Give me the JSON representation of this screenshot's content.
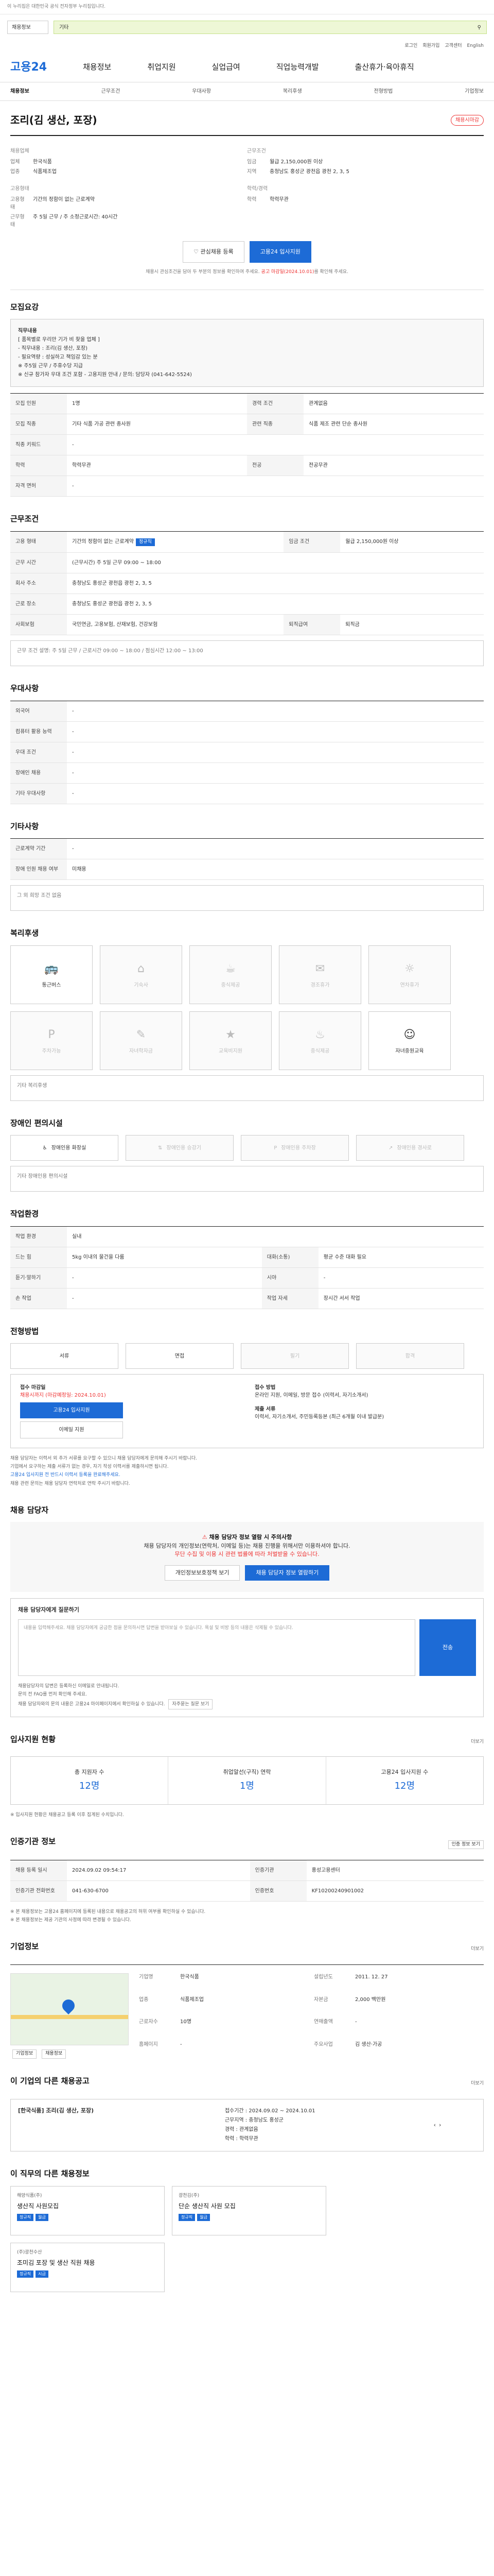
{
  "topbar": {
    "text": "이 누리집은 대한민국 공식 전자정부 누리집입니다."
  },
  "search": {
    "category": "채용정보",
    "query": "기타"
  },
  "gnb_top": [
    "로그인",
    "회원가입",
    "고객센터",
    "English"
  ],
  "gnb": {
    "logo": "고용24",
    "items": [
      "채용정보",
      "취업지원",
      "실업급여",
      "직업능력개발",
      "출산휴가·육아휴직"
    ]
  },
  "subnav": [
    "채용정보",
    "근무조건",
    "우대사항",
    "복리후생",
    "전형방법",
    "기업정보"
  ],
  "title": "조리(김 생산, 포장)",
  "status": "채용시마감",
  "company": {
    "label": "채용업체",
    "name_k": "업체",
    "name": "한국식품",
    "type_k": "업종",
    "type": "식품제조업"
  },
  "conditions": {
    "label": "근무조건",
    "pay_k": "임금",
    "pay": "월급 2,150,000원 이상",
    "loc_k": "지역",
    "loc": "충청남도 홍성군 광천읍 광천 2, 3, 5"
  },
  "qual": {
    "label": "고용형태",
    "emp_k": "고용형태",
    "emp": "기간의 정함이 없는 근로계약",
    "hours_k": "근무형태",
    "hours": "주 5일 근무 / 주 소정근로시간: 40시간"
  },
  "career": {
    "label": "학력/경력",
    "edu_k": "학력",
    "edu": "학력무관"
  },
  "buttons": {
    "interest": "관심채용 등록",
    "apply": "고용24 입사지원"
  },
  "notice": {
    "pre": "채용시 관심조건을 담아 두 부분의 정보를 확인하여 주세요. ",
    "red": "공고 마감일(2024.10.01)",
    "post": "를 확인해 주세요."
  },
  "recruit": {
    "title": "모집요강",
    "box_title": "직무내용",
    "box_lines": [
      "[ 품목별로 우리만 기가 비 찾을 업체 ]",
      "- 직무내용 : 조리(김 생산, 포장)",
      "- 필요역량 : 성실하고 책임감 있는 분",
      "※ 주5일 근무 / 주휴수당 지급",
      "※ 신규 참가자 우대 조건 포함 - 고용지원 안내 / 문의: 담당자 (041-642-5524)"
    ],
    "rows": [
      {
        "k1": "모집 인원",
        "v1": "1명",
        "k2": "경력 조건",
        "v2": "관계없음"
      },
      {
        "k1": "모집 직종",
        "v1": "기타 식품 가공 관련 종사원",
        "k2": "관련 직종",
        "v2": "식품 제조 관련 단순 종사원"
      },
      {
        "k1": "직종 키워드",
        "v1": "-",
        "k2": "",
        "v2": ""
      },
      {
        "k1": "학력",
        "v1": "학력무관",
        "k2": "전공",
        "v2": "전공무관"
      },
      {
        "k1": "자격 면허",
        "v1": "-",
        "k2": "",
        "v2": ""
      }
    ]
  },
  "work": {
    "title": "근무조건",
    "rows": [
      {
        "k1": "고용 형태",
        "v1": "기간의 정함이 없는 근로계약",
        "tag": "정규직",
        "k2": "임금 조건",
        "v2": "월급 2,150,000원 이상"
      },
      {
        "k1": "근무 시간",
        "v1": "(근무시간) 주 5일 근무 09:00 ~ 18:00",
        "tag": "",
        "k2": "",
        "v2": ""
      },
      {
        "k1": "회사 주소",
        "v1": "충청남도 홍성군 광천읍 광천 2, 3, 5",
        "tag": "",
        "k2": "",
        "v2": ""
      },
      {
        "k1": "근로 장소",
        "v1": "충청남도 홍성군 광천읍 광천 2, 3, 5",
        "tag": "",
        "k2": "",
        "v2": ""
      },
      {
        "k1": "사회보험",
        "v1": "국민연금, 고용보험, 산재보험, 건강보험",
        "tag": "",
        "k2": "퇴직급여",
        "v2": "퇴직금"
      }
    ],
    "extra": "근무 조건 설명: 주 5일 근무 / 근로시간 09:00 ~ 18:00 / 점심시간 12:00 ~ 13:00"
  },
  "preferences": {
    "title": "우대사항",
    "rows": [
      {
        "k": "외국어",
        "v": "-"
      },
      {
        "k": "컴퓨터 활용 능력",
        "v": "-"
      },
      {
        "k": "우대 조건",
        "v": "-"
      },
      {
        "k": "장애인 채용",
        "v": "-"
      },
      {
        "k": "기타 우대사항",
        "v": "-"
      }
    ]
  },
  "other": {
    "title": "기타사항",
    "rows": [
      {
        "k": "근로계약 기간",
        "v": "-"
      },
      {
        "k": "장애 인원 채용 여부",
        "v": "미채용"
      }
    ],
    "box": "그 외 희망 조건 없음"
  },
  "welfare": {
    "title": "복리후생",
    "items": [
      "통근버스",
      "기숙사",
      "중식제공",
      "경조휴가",
      "연차휴가",
      "주차가능",
      "자녀학자금",
      "교육비지원",
      "중식제공",
      "자녀중원교육"
    ],
    "active": [
      0,
      9
    ],
    "note": "기타 복리후생"
  },
  "disability": {
    "title": "장애인 편의시설",
    "items": [
      "장애인용 화장실",
      "장애인용 승강기",
      "장애인용 주차장",
      "장애인용 경사로"
    ],
    "note": "기타 장애인용 편의시설"
  },
  "job_env": {
    "title": "작업환경",
    "rows": [
      {
        "k1": "작업 환경",
        "v1": "실내",
        "k2": "",
        "v2": ""
      },
      {
        "k1": "드는 힘",
        "v1": "5kg 이내의 물건을 다룸",
        "k2": "대화(소통)",
        "v2": "평균 수준 대화 필요"
      },
      {
        "k1": "듣기·말하기",
        "v1": "-",
        "k2": "시야",
        "v2": "-"
      },
      {
        "k1": "손 작업",
        "v1": "-",
        "k2": "작업 자세",
        "v2": "장시간 서서 작업"
      }
    ]
  },
  "process": {
    "title": "전형방법",
    "steps": [
      "서류",
      "면접",
      "필기",
      "합격"
    ],
    "recv_title": "접수 마감일",
    "recv_date": "채용시까지 (마감예정일: 2024.10.01)",
    "apply_btn": "고용24 입사지원",
    "email_btn": "이메일 지원",
    "docs_title": "접수 방법",
    "docs": "온라인 지원, 이메일, 방문 접수 (이력서, 자기소개서)",
    "result_title": "제출 서류",
    "result": "이력서, 자기소개서, 주민등록등본 (최근 6개월 이내 발급분)",
    "hints": [
      "채용 담당자는 이력서 외 추가 서류를 요구할 수 있으니 채용 담당자에게 문의해 주시기 바랍니다.",
      "기업에서 요구하는 제출 서류가 없는 경우, 자기 작성 이력서를 제출하시면 됩니다.",
      "고용24 입사지원 전 반드시 이력서 등록을 완료해주세요.",
      "채용 관련 문의는 채용 담당자 연락처로 연락 주시기 바랍니다."
    ]
  },
  "manager": {
    "title": "채용 담당자",
    "warn_title": "채용 담당자 정보 열람 시 주의사항",
    "warn": "채용 담당자의 개인정보(연락처, 이메일 등)는 채용 진행을 위해서만 이용하셔야 합니다.",
    "red": "무단 수집 및 이용 시 관련 법률에 따라 처벌받을 수 있습니다.",
    "btn1": "개인정보보호정책 보기",
    "btn2": "채용 담당자 정보 열람하기"
  },
  "qa": {
    "title": "채용 담당자에게 질문하기",
    "placeholder": "내용을 입력해주세요. 채용 담당자에게 궁금한 점을 문의하시면 답변을 받아보실 수 있습니다. 욕설 및 비방 등의 내용은 삭제될 수 있습니다.",
    "send": "전송",
    "hints": [
      "채용담당자의 답변은 등록하신 이메일로 안내됩니다.",
      "문의 전 FAQ를 먼저 확인해 주세요.",
      "채용 담당자와의 문의 내용은 고용24 마이페이지에서 확인하실 수 있습니다."
    ],
    "faq_btn": "자주묻는 질문 보기"
  },
  "apply_stats": {
    "title": "입사지원 현황",
    "more": "더보기",
    "items": [
      {
        "label": "총 지원자 수",
        "value": "12명"
      },
      {
        "label": "취업알선(구직) 연락",
        "value": "1명"
      },
      {
        "label": "고용24 입사지원 수",
        "value": "12명"
      }
    ],
    "note": "※ 입사지원 현황은 채용공고 등록 이후 집계된 수치입니다."
  },
  "info": {
    "title": "인증기관 정보",
    "btn": "인증 정보 보기",
    "rows": [
      {
        "k1": "채용 등록 일시",
        "v1": "2024.09.02 09:54:17",
        "k2": "인증기관",
        "v2": "홍성고용센터"
      },
      {
        "k1": "인증기관 전화번호",
        "v1": "041-630-6700",
        "k2": "인증번호",
        "v2": "KF10200240901002"
      }
    ],
    "notes": [
      "※ 본 채용정보는 고용24 홈페이지에 등록된 내용으로 채용공고의 허위 여부를 확인하실 수 있습니다.",
      "※ 본 채용정보는 제공 기관의 사정에 따라 변경될 수 있습니다."
    ]
  },
  "company_info": {
    "title": "기업정보",
    "more": "더보기",
    "btn1": "기업정보",
    "btn2": "채용정보",
    "rows": [
      {
        "k1": "기업명",
        "v1": "한국식품",
        "k2": "설립년도",
        "v2": "2011. 12. 27"
      },
      {
        "k1": "업종",
        "v1": "식품제조업",
        "k2": "자본금",
        "v2": "2,000 백만원"
      },
      {
        "k1": "근로자수",
        "v1": "10명",
        "k2": "연매출액",
        "v2": "-"
      },
      {
        "k1": "홈페이지",
        "v1": "-",
        "k2": "주요사업",
        "v2": "김 생산·가공"
      }
    ]
  },
  "other_jobs": {
    "title": "이 기업의 다른 채용공고",
    "more": "더보기",
    "desc_title": "[한국식품] 조리(김 생산, 포장)",
    "lines": [
      "접수기간 : 2024.09.02 ~ 2024.10.01",
      "근무지역 : 충청남도 홍성군",
      "경력 : 관계없음",
      "학력 : 학력무관"
    ]
  },
  "related": {
    "title": "이 직무의 다른 채용정보",
    "cards": [
      {
        "co": "해양식품(주)",
        "title": "생산직 사원모집",
        "labels": [
          "정규직",
          "월급"
        ]
      },
      {
        "co": "광천김(주)",
        "title": "단순 생산직 사원 모집",
        "labels": [
          "정규직",
          "월급"
        ]
      },
      {
        "co": "(주)광천수산",
        "title": "조미김 포장 및 생산 직원 채용",
        "labels": [
          "정규직",
          "시급"
        ]
      }
    ]
  }
}
